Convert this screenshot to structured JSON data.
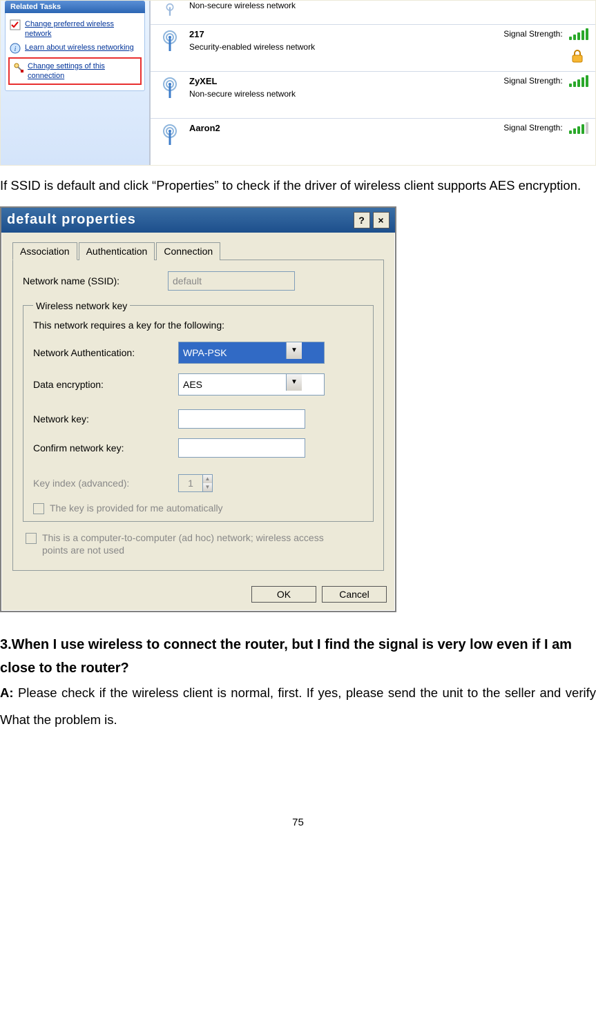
{
  "sidebar": {
    "groupTitle": "Related Tasks",
    "links": [
      {
        "label": "Change preferred wireless network"
      },
      {
        "label": "Learn about wireless networking"
      },
      {
        "label": "Change settings of this connection"
      }
    ]
  },
  "networks": [
    {
      "name": "",
      "desc": "Non-secure wireless network",
      "signal": "",
      "bars": 0,
      "lock": false
    },
    {
      "name": "217",
      "desc": "Security-enabled wireless network",
      "signal": "Signal Strength:",
      "bars": 5,
      "lock": true
    },
    {
      "name": "ZyXEL",
      "desc": "Non-secure wireless network",
      "signal": "Signal Strength:",
      "bars": 5,
      "lock": false
    },
    {
      "name": "Aaron2",
      "desc": "",
      "signal": "Signal Strength:",
      "bars": 4,
      "lock": false
    }
  ],
  "para1": "If SSID is default and click “Properties” to check if the driver of wireless client supports AES encryption.",
  "dialog": {
    "title": "default properties",
    "tabs": [
      "Association",
      "Authentication",
      "Connection"
    ],
    "ssidLabel": "Network name (SSID):",
    "ssidValue": "default",
    "groupTitle": "Wireless network key",
    "groupNote": "This network requires a key for the following:",
    "authLabel": "Network Authentication:",
    "authValue": "WPA-PSK",
    "encLabel": "Data encryption:",
    "encValue": "AES",
    "keyLabel": "Network key:",
    "confirmLabel": "Confirm network key:",
    "idxLabel": "Key index (advanced):",
    "idxValue": "1",
    "autoLabel": "The key is provided for me automatically",
    "adhocLabel": "This is a computer-to-computer (ad hoc) network; wireless access points are not used",
    "ok": "OK",
    "cancel": "Cancel"
  },
  "q3": {
    "heading": "3.When I use wireless to connect the router, but I find the signal is very low even if I am close to the router?",
    "aPrefix": "A: ",
    "answer": "Please check if the wireless client is normal, first. If yes, please send the unit to the seller and verify What the problem is."
  },
  "pageNum": "75"
}
